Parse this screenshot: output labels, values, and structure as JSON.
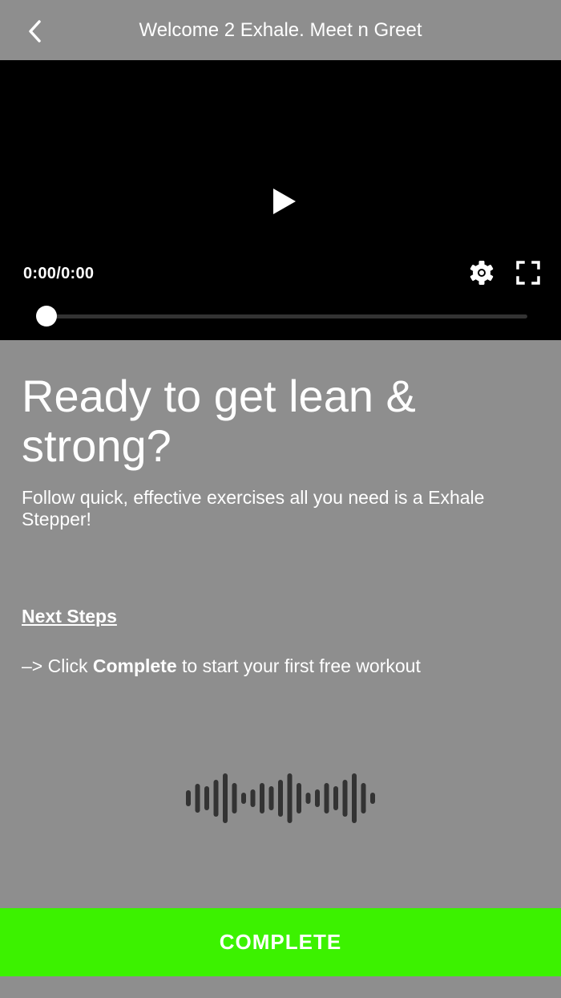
{
  "header": {
    "back_icon": "chevron-left-icon",
    "title": "Welcome 2 Exhale. Meet n Greet"
  },
  "video": {
    "play_icon": "play-icon",
    "time": "0:00/0:00",
    "settings_icon": "gear-icon",
    "fullscreen_icon": "fullscreen-icon",
    "progress": 0
  },
  "content": {
    "headline": "Ready to get lean & strong?",
    "subtitle": "Follow quick, effective exercises all you need is a Exhale Stepper!",
    "next_steps_label": "Next Steps",
    "instruction_prefix": "–> Click ",
    "instruction_bold": "Complete",
    "instruction_suffix": " to start your first free workout",
    "waveform_icon": "audio-waveform-icon"
  },
  "footer": {
    "complete_label": "COMPLETE"
  },
  "colors": {
    "background": "#8e8e8e",
    "video_background": "#000000",
    "accent_green": "#3cf200",
    "waveform": "#333333"
  }
}
